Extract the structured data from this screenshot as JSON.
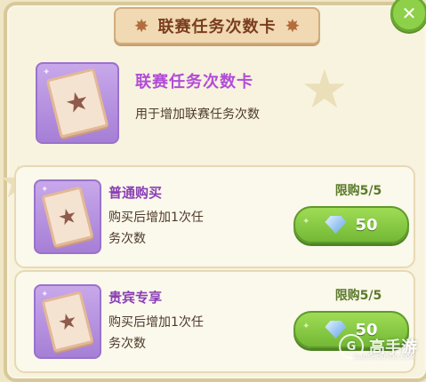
{
  "dialog": {
    "title": "联赛任务次数卡",
    "close_icon": "✕"
  },
  "item": {
    "name": "联赛任务次数卡",
    "description": "用于增加联赛任务次数",
    "icon": "star-ticket-icon"
  },
  "offers": [
    {
      "name": "普通购买",
      "description": "购买后增加1次任务次数",
      "limit": "限购5/5",
      "price": "50",
      "currency_icon": "diamond-icon"
    },
    {
      "name": "贵宾专享",
      "description": "购买后增加1次任务次数",
      "limit": "限购5/5",
      "price": "50",
      "currency_icon": "diamond-icon"
    }
  ],
  "watermark": {
    "text": "高手游",
    "subtext": "GAOSHOUYOU.COM",
    "logo": "G"
  },
  "colors": {
    "panel_bg": "#f8f3df",
    "title_plate": "#f0d9b3",
    "item_name": "#b14cd8",
    "buy_button": "#8fd04a",
    "close_button": "#8fd04a"
  }
}
